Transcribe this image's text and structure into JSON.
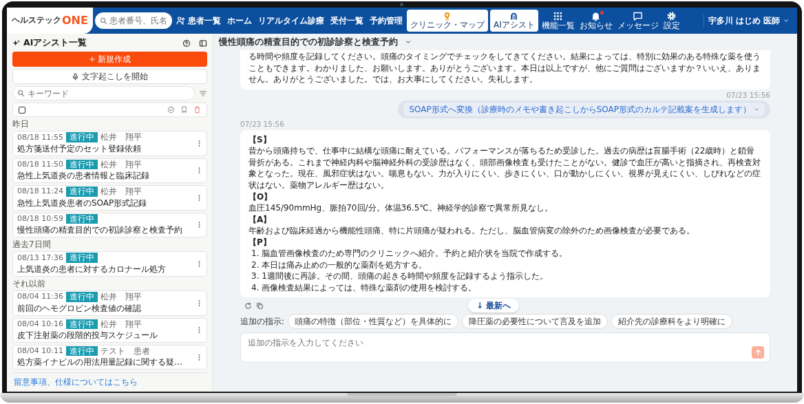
{
  "nav": {
    "logo_main": "ヘルステック",
    "logo_accent": "ONE",
    "search": {
      "placeholder": "患者番号、氏名"
    },
    "patients_link": "患者一覧",
    "links": [
      "ホーム",
      "リアルタイム診療",
      "受付一覧",
      "予約管理"
    ],
    "app_buttons": [
      {
        "label": "クリニック・マップ"
      },
      {
        "label": "AIアシスト"
      }
    ],
    "icon_items": [
      {
        "label": "機能一覧",
        "unread": false
      },
      {
        "label": "お知らせ",
        "unread": true
      },
      {
        "label": "メッセージ",
        "unread": false
      },
      {
        "label": "設定",
        "unread": false
      }
    ],
    "user": "宇多川 はじめ 医師"
  },
  "sidebar": {
    "title": "AIアシスト一覧",
    "new_button": "新規作成",
    "transcribe_button": "文字起こしを開始",
    "search": {
      "placeholder": "キーワード"
    },
    "select_all": {
      "checked": false
    },
    "groups": [
      {
        "label": "昨日",
        "items": [
          {
            "time": "08/18 11:55",
            "status": "進行中",
            "author": "松井　翔平",
            "title": "処方箋送付予定のセット登録依頼"
          },
          {
            "time": "08/18 11:50",
            "status": "進行中",
            "author": "松井　翔平",
            "title": "急性上気道炎の患者情報と臨床記録"
          },
          {
            "time": "08/18 11:24",
            "status": "進行中",
            "author": "松井　翔平",
            "title": "急性上気道炎患者のSOAP形式記録"
          },
          {
            "time": "08/18 10:59",
            "status": "進行中",
            "title": "慢性頭痛の精査目的での初診診察と検査予約"
          }
        ]
      },
      {
        "label": "過去7日間",
        "items": [
          {
            "time": "08/13 17:36",
            "status": "進行中",
            "title": "上気道炎の患者に対するカロナール処方"
          }
        ]
      },
      {
        "label": "それ以前",
        "items": [
          {
            "time": "08/04 11:36",
            "status": "進行中",
            "author": "松井　翔平",
            "title": "前回のヘモグロビン検査値の確認"
          },
          {
            "time": "08/04 10:16",
            "status": "進行中",
            "author": "松井　翔平",
            "title": "皮下注射薬の段階的投与スケジュール"
          },
          {
            "time": "08/04 10:11",
            "status": "進行中",
            "author": "テスト　患者",
            "title": "処方薬イナビルの用法用量記録に関する疑…"
          }
        ]
      }
    ],
    "footer_link": "留意事項、仕様についてはこちら"
  },
  "chat": {
    "title": "慢性頭痛の精査目的での初診診察と検査予約",
    "messages": [
      {
        "kind": "assistant",
        "text": "る時間や頻度を記録してください。頭痛のタイミングでチェックをしてきてください。結果によっては、特別に効果のある特殊な薬を使うこともできます。わかりました、お願いします。ありがとうございます。本日は以上ですが、他にご質問はございますか？いいえ、ありません。ありがとうございました。では、お大事にしてください。失礼します。"
      },
      {
        "kind": "user",
        "time": "07/23 15:56",
        "command": "SOAP形式へ変換（診療時のメモや書き起こしからSOAP形式のカルテ記載案を生成します）"
      },
      {
        "kind": "assistant",
        "time": "07/23 15:56",
        "lines": [
          {
            "kind": "heading",
            "text": "【S】"
          },
          {
            "kind": "text",
            "text": "昔から頭痛持ちで、仕事中に結構な頭痛に耐えている。パフォーマンスが落ちるため受診した。過去の病歴は盲腸手術（22歳時）と鎖骨骨折がある。これまで神経内科や脳神経外科の受診歴はなく、頭部画像検査も受けたことがない。健診で血圧が高いと指摘され、再検査対象となった。現在、風邪症状はない。喘息もない。力が入りにくい、歩きにくい、口が動かしにくい、視界が見えにくい、しびれなどの症状はない。薬物アレルギー歴はない。"
          },
          {
            "kind": "heading",
            "text": "【O】"
          },
          {
            "kind": "text",
            "text": "血圧145/90mmHg、脈拍70回/分。体温36.5℃。神経学的診察で異常所見なし。"
          },
          {
            "kind": "heading",
            "text": "【A】"
          },
          {
            "kind": "text",
            "text": "年齢および臨床経過から機能性頭痛、特に片頭痛が疑われる。ただし、脳血管病変の除外のため画像検査が必要である。"
          },
          {
            "kind": "heading",
            "text": "【P】"
          },
          {
            "kind": "item",
            "text": "1. 脳血管画像検査のため専門のクリニックへ紹介。予約と紹介状を当院で作成する。"
          },
          {
            "kind": "item",
            "text": "2. 本日は痛み止めの一般的な薬剤を処方する。"
          },
          {
            "kind": "item",
            "text": "3. 1週間後に再診。その間、頭痛の起きる時間や頻度を記録するよう指示した。"
          },
          {
            "kind": "item",
            "text": "4. 画像検査結果によっては、特殊な薬剤の使用を検討する。"
          }
        ]
      }
    ],
    "scroll_button": "↓ 最新へ",
    "suggestions": {
      "label": "追加の指示:",
      "chips": [
        "頭痛の特徴（部位・性質など）を具体的に",
        "降圧薬の必要性について言及を追加",
        "紹介先の診療科をより明確に"
      ]
    },
    "input": {
      "placeholder": "追加の指示を入力してください"
    }
  }
}
